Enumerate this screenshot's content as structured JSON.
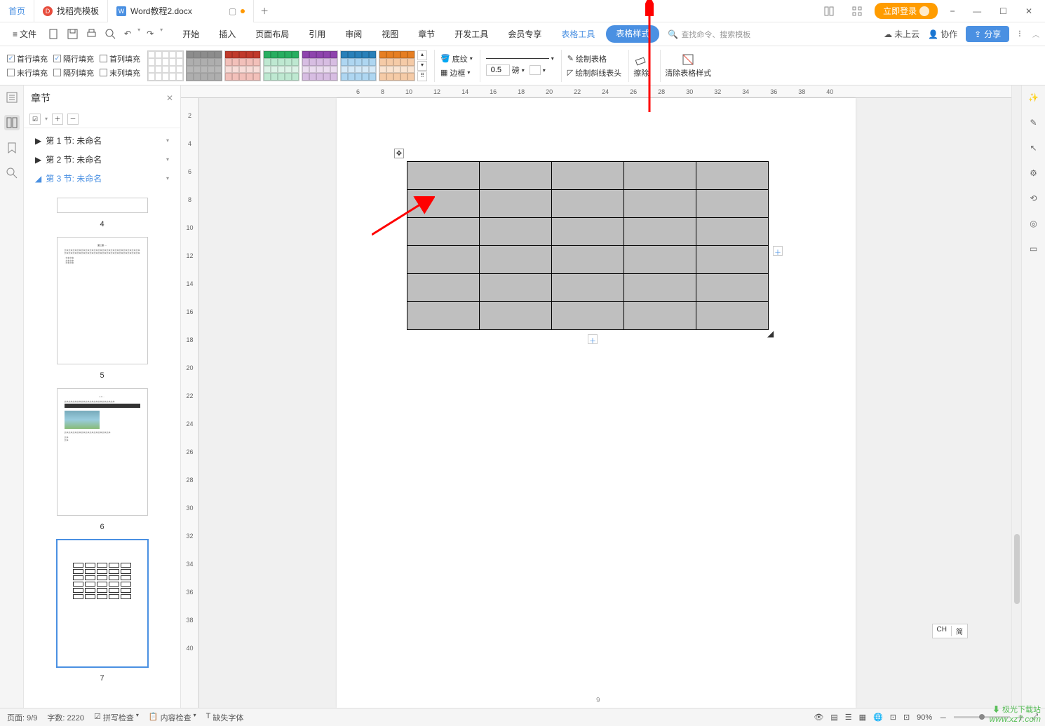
{
  "tabs": {
    "home": "首页",
    "second": "找稻壳模板",
    "active": "Word教程2.docx"
  },
  "titlebar": {
    "login": "立即登录"
  },
  "menubar": {
    "file": "文件",
    "tabs": [
      "开始",
      "插入",
      "页面布局",
      "引用",
      "审阅",
      "视图",
      "章节",
      "开发工具",
      "会员专享"
    ],
    "table_tools": "表格工具",
    "table_style": "表格样式",
    "search_ph": "查找命令、搜索模板",
    "cloud": "未上云",
    "coop": "协作",
    "share": "分享"
  },
  "ribbon": {
    "fills": {
      "row1": [
        "首行填充",
        "隔行填充",
        "首列填充"
      ],
      "row2": [
        "末行填充",
        "隔列填充",
        "末列填充"
      ],
      "checked": [
        true,
        true,
        false,
        false,
        false,
        false
      ]
    },
    "shading": "底纹",
    "border": "边框",
    "width_val": "0.5",
    "width_unit": "磅",
    "draw_table": "绘制表格",
    "draw_diag": "绘制斜线表头",
    "erase": "擦除",
    "clear_style": "清除表格样式"
  },
  "nav": {
    "title": "章节",
    "sections": [
      {
        "label": "第 1 节: 未命名",
        "expand": "▶"
      },
      {
        "label": "第 2 节: 未命名",
        "expand": "▶"
      },
      {
        "label": "第 3 节: 未命名",
        "expand": "◢",
        "current": true
      }
    ],
    "thumbs": [
      "4",
      "5",
      "6",
      "7"
    ]
  },
  "ruler_h": [
    "6",
    "8",
    "10",
    "12",
    "14",
    "16",
    "18",
    "20",
    "22",
    "24",
    "26",
    "28",
    "30",
    "32",
    "34",
    "36",
    "38",
    "40"
  ],
  "ruler_v": [
    "2",
    "4",
    "6",
    "8",
    "10",
    "12",
    "14",
    "16",
    "18",
    "20",
    "22",
    "24",
    "26",
    "28",
    "30",
    "32",
    "34",
    "36",
    "38",
    "40"
  ],
  "page": {
    "num": "9"
  },
  "ime": {
    "left": "CH",
    "right": "简"
  },
  "status": {
    "page": "页面: 9/9",
    "words": "字数: 2220",
    "spell": "拼写检查",
    "content": "内容检查",
    "missing_font": "缺失字体",
    "zoom": "90%"
  },
  "watermark": {
    "site": "极光下载站",
    "url": "www.xz7.com"
  }
}
